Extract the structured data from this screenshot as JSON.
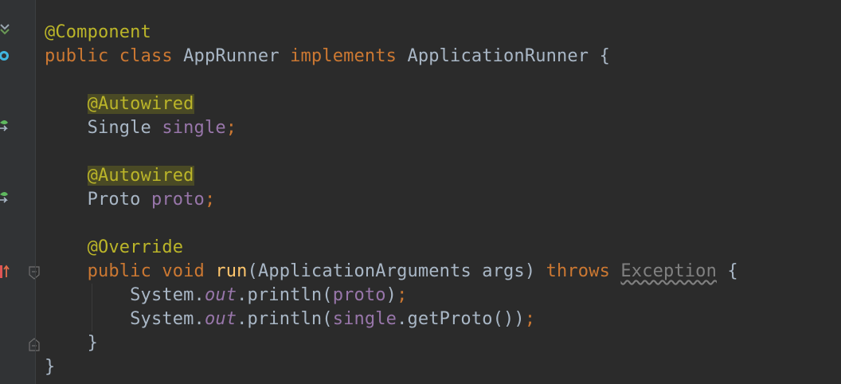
{
  "editor": {
    "language": "Java",
    "lines": [
      [
        {
          "t": "@Component",
          "c": "ann"
        }
      ],
      [
        {
          "t": "public ",
          "c": "kw"
        },
        {
          "t": "class ",
          "c": "kw"
        },
        {
          "t": "AppRunner "
        },
        {
          "t": "implements ",
          "c": "kw"
        },
        {
          "t": "ApplicationRunner {"
        }
      ],
      [
        {
          "t": ""
        }
      ],
      [
        {
          "t": "    "
        },
        {
          "t": "@Autowired",
          "c": "ann-hl"
        }
      ],
      [
        {
          "t": "    Single "
        },
        {
          "t": "single",
          "c": "field"
        },
        {
          "t": ";",
          "c": "punc"
        }
      ],
      [
        {
          "t": ""
        }
      ],
      [
        {
          "t": "    "
        },
        {
          "t": "@Autowired",
          "c": "ann-hl"
        }
      ],
      [
        {
          "t": "    Proto "
        },
        {
          "t": "proto",
          "c": "field"
        },
        {
          "t": ";",
          "c": "punc"
        }
      ],
      [
        {
          "t": ""
        }
      ],
      [
        {
          "t": "    "
        },
        {
          "t": "@Override",
          "c": "ann"
        }
      ],
      [
        {
          "t": "    "
        },
        {
          "t": "public ",
          "c": "kw"
        },
        {
          "t": "void ",
          "c": "kw"
        },
        {
          "t": "run",
          "c": "fn"
        },
        {
          "t": "(ApplicationArguments args) "
        },
        {
          "t": "throws ",
          "c": "kw"
        },
        {
          "t": "Exception",
          "c": "unused"
        },
        {
          "t": " {"
        }
      ],
      [
        {
          "t": "        System."
        },
        {
          "t": "out",
          "c": "static"
        },
        {
          "t": ".println("
        },
        {
          "t": "proto",
          "c": "field"
        },
        {
          "t": ")"
        },
        {
          "t": ";",
          "c": "punc"
        }
      ],
      [
        {
          "t": "        System."
        },
        {
          "t": "out",
          "c": "static"
        },
        {
          "t": ".println("
        },
        {
          "t": "single",
          "c": "field"
        },
        {
          "t": ".getProto())"
        },
        {
          "t": ";",
          "c": "punc"
        }
      ],
      [
        {
          "t": "    }"
        }
      ],
      [
        {
          "t": "}"
        }
      ]
    ]
  },
  "gutter_icons": [
    {
      "name": "spring-bean-icon",
      "line": 0
    },
    {
      "name": "implemented-class-icon",
      "line": 1
    },
    {
      "name": "autowired-navigate-icon",
      "line": 4
    },
    {
      "name": "autowired-navigate-icon",
      "line": 7
    },
    {
      "name": "override-method-icon",
      "line": 10
    },
    {
      "name": "fold-start-icon",
      "line": 10
    },
    {
      "name": "fold-end-icon",
      "line": 13
    }
  ],
  "colors": {
    "background": "#2b2b2b",
    "gutter": "#313335",
    "text": "#a9b7c6",
    "keyword": "#cc7832",
    "annotation": "#bbb529",
    "field": "#9876aa",
    "method": "#ffc66d"
  }
}
